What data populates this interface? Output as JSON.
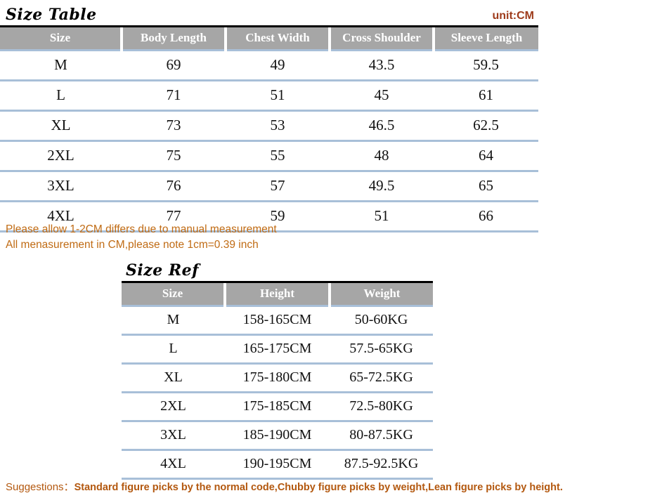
{
  "size_table": {
    "title": "Size Table",
    "unit_label": "unit:CM",
    "columns": [
      "Size",
      "Body Length",
      "Chest Width",
      "Cross Shoulder",
      "Sleeve Length"
    ],
    "rows": [
      {
        "size": "M",
        "body_length": "69",
        "chest_width": "49",
        "cross_shoulder": "43.5",
        "sleeve_length": "59.5"
      },
      {
        "size": "L",
        "body_length": "71",
        "chest_width": "51",
        "cross_shoulder": "45",
        "sleeve_length": "61"
      },
      {
        "size": "XL",
        "body_length": "73",
        "chest_width": "53",
        "cross_shoulder": "46.5",
        "sleeve_length": "62.5"
      },
      {
        "size": "2XL",
        "body_length": "75",
        "chest_width": "55",
        "cross_shoulder": "48",
        "sleeve_length": "64"
      },
      {
        "size": "3XL",
        "body_length": "76",
        "chest_width": "57",
        "cross_shoulder": "49.5",
        "sleeve_length": "65"
      },
      {
        "size": "4XL",
        "body_length": "77",
        "chest_width": "59",
        "cross_shoulder": "51",
        "sleeve_length": "66"
      }
    ]
  },
  "notes": {
    "line1": "Please allow 1-2CM differs due to manual measurement",
    "line2": "All menasurement in CM,please note 1cm=0.39 inch"
  },
  "size_ref": {
    "title": "Size Ref",
    "columns": [
      "Size",
      "Height",
      "Weight"
    ],
    "rows": [
      {
        "size": "M",
        "height": "158-165CM",
        "weight": "50-60KG"
      },
      {
        "size": "L",
        "height": "165-175CM",
        "weight": "57.5-65KG"
      },
      {
        "size": "XL",
        "height": "175-180CM",
        "weight": "65-72.5KG"
      },
      {
        "size": "2XL",
        "height": "175-185CM",
        "weight": "72.5-80KG"
      },
      {
        "size": "3XL",
        "height": "185-190CM",
        "weight": "80-87.5KG"
      },
      {
        "size": "4XL",
        "height": "190-195CM",
        "weight": "87.5-92.5KG"
      }
    ]
  },
  "suggestions": {
    "label": "Suggestions：",
    "text": "Standard figure picks by the normal code,Chubby figure picks by weight,Lean figure  picks by height."
  },
  "colors": {
    "header_bg": "#a6a6a6",
    "header_text": "#ffffff",
    "rule_blue": "#a8bfd8",
    "unit_red": "#9e3b1b",
    "note_orange": "#c06b14",
    "suggestion_orange": "#b3580f",
    "title_black": "#000000"
  }
}
